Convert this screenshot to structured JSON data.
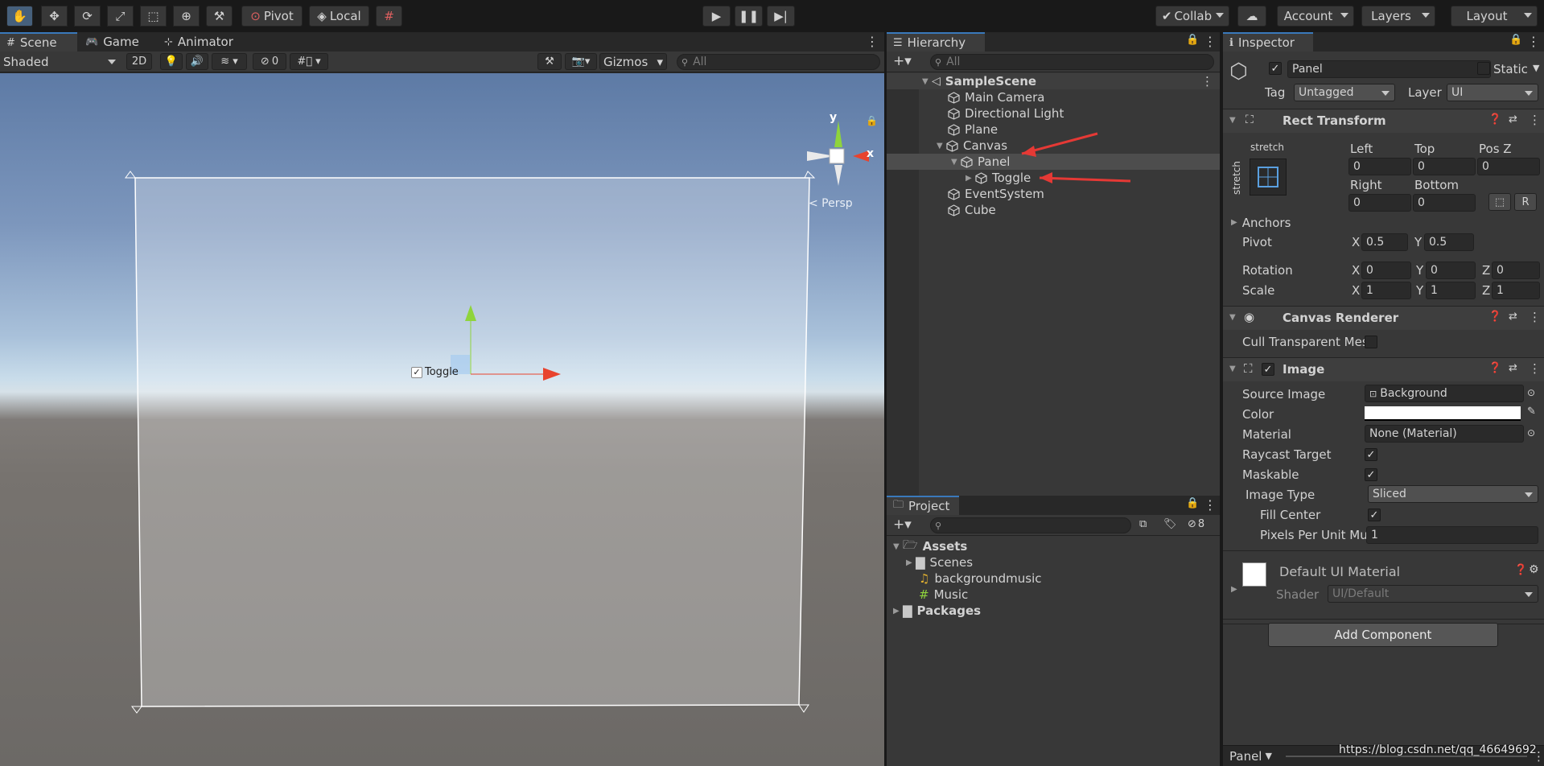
{
  "toolbar": {
    "pivot": "Pivot",
    "local": "Local",
    "collab": "Collab",
    "account": "Account",
    "layers": "Layers",
    "layout": "Layout"
  },
  "scene": {
    "tabs": [
      "Scene",
      "Game",
      "Animator"
    ],
    "shading": "Shaded",
    "mode2d": "2D",
    "hidden_count": "0",
    "gizmos": "Gizmos",
    "search_placeholder": "All",
    "persp": "< Persp",
    "axis_x": "x",
    "axis_y": "y",
    "toggle_label": "Toggle"
  },
  "hierarchy": {
    "tab": "Hierarchy",
    "search_placeholder": "All",
    "scene_name": "SampleScene",
    "items": [
      "Main Camera",
      "Directional Light",
      "Plane",
      "Canvas",
      "Panel",
      "Toggle",
      "EventSystem",
      "Cube"
    ]
  },
  "project": {
    "tab": "Project",
    "hidden_count": "8",
    "items": [
      "Assets",
      "Scenes",
      "backgroundmusic",
      "Music",
      "Packages"
    ]
  },
  "inspector": {
    "tab": "Inspector",
    "name": "Panel",
    "static": "Static",
    "tag_label": "Tag",
    "tag_value": "Untagged",
    "layer_label": "Layer",
    "layer_value": "UI",
    "rect": {
      "title": "Rect Transform",
      "stretch_top": "stretch",
      "stretch_side": "stretch",
      "left_label": "Left",
      "left": "0",
      "top_label": "Top",
      "top": "0",
      "posz_label": "Pos Z",
      "posz": "0",
      "right_label": "Right",
      "right": "0",
      "bottom_label": "Bottom",
      "bottom": "0",
      "r_button": "R",
      "anchors": "Anchors",
      "pivot": "Pivot",
      "pivot_x": "0.5",
      "pivot_y": "0.5",
      "rotation": "Rotation",
      "rot_x": "0",
      "rot_y": "0",
      "rot_z": "0",
      "scale": "Scale",
      "scale_x": "1",
      "scale_y": "1",
      "scale_z": "1",
      "x": "X",
      "y": "Y",
      "z": "Z"
    },
    "canvas_renderer": {
      "title": "Canvas Renderer",
      "cull": "Cull Transparent Mes"
    },
    "image": {
      "title": "Image",
      "source_image_label": "Source Image",
      "source_image": "Background",
      "color_label": "Color",
      "material_label": "Material",
      "material": "None (Material)",
      "raycast_label": "Raycast Target",
      "maskable_label": "Maskable",
      "image_type_label": "Image Type",
      "image_type": "Sliced",
      "fill_center_label": "Fill Center",
      "ppu_label": "Pixels Per Unit Mu",
      "ppu": "1"
    },
    "material": {
      "name": "Default UI Material",
      "shader_label": "Shader",
      "shader": "UI/Default"
    },
    "add_component": "Add Component",
    "footer": "Panel"
  },
  "watermark": "https://blog.csdn.net/qq_46649692",
  "colors": {
    "accent": "#3a79bb",
    "selected_row": "#4d4d4d",
    "annotation_arrow": "#e53935",
    "gizmo_x": "#e8432e",
    "gizmo_y": "#8fd43c"
  }
}
